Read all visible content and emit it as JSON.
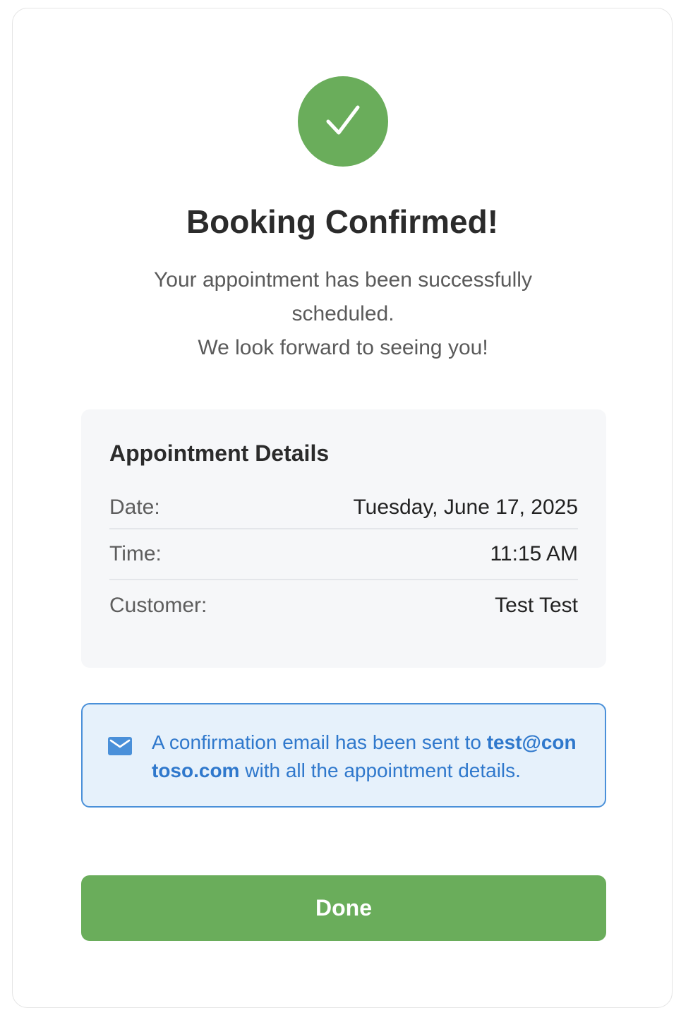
{
  "header": {
    "title": "Booking Confirmed!",
    "subtitle_line1": "Your appointment has been successfully scheduled.",
    "subtitle_line2": "We look forward to seeing you!"
  },
  "details": {
    "heading": "Appointment Details",
    "rows": [
      {
        "label": "Date:",
        "value": "Tuesday, June 17, 2025"
      },
      {
        "label": "Time:",
        "value": "11:15 AM"
      },
      {
        "label": "Customer:",
        "value": "Test Test"
      }
    ]
  },
  "notice": {
    "icon": "mail-icon",
    "prefix": "A confirmation email has been sent to ",
    "email": "test@contoso.com",
    "suffix": " with all the appointment details."
  },
  "actions": {
    "done_label": "Done"
  },
  "colors": {
    "success": "#6aad5b",
    "info_text": "#2f78cc",
    "info_border": "#4a90d9",
    "info_bg": "#e6f1fb"
  }
}
